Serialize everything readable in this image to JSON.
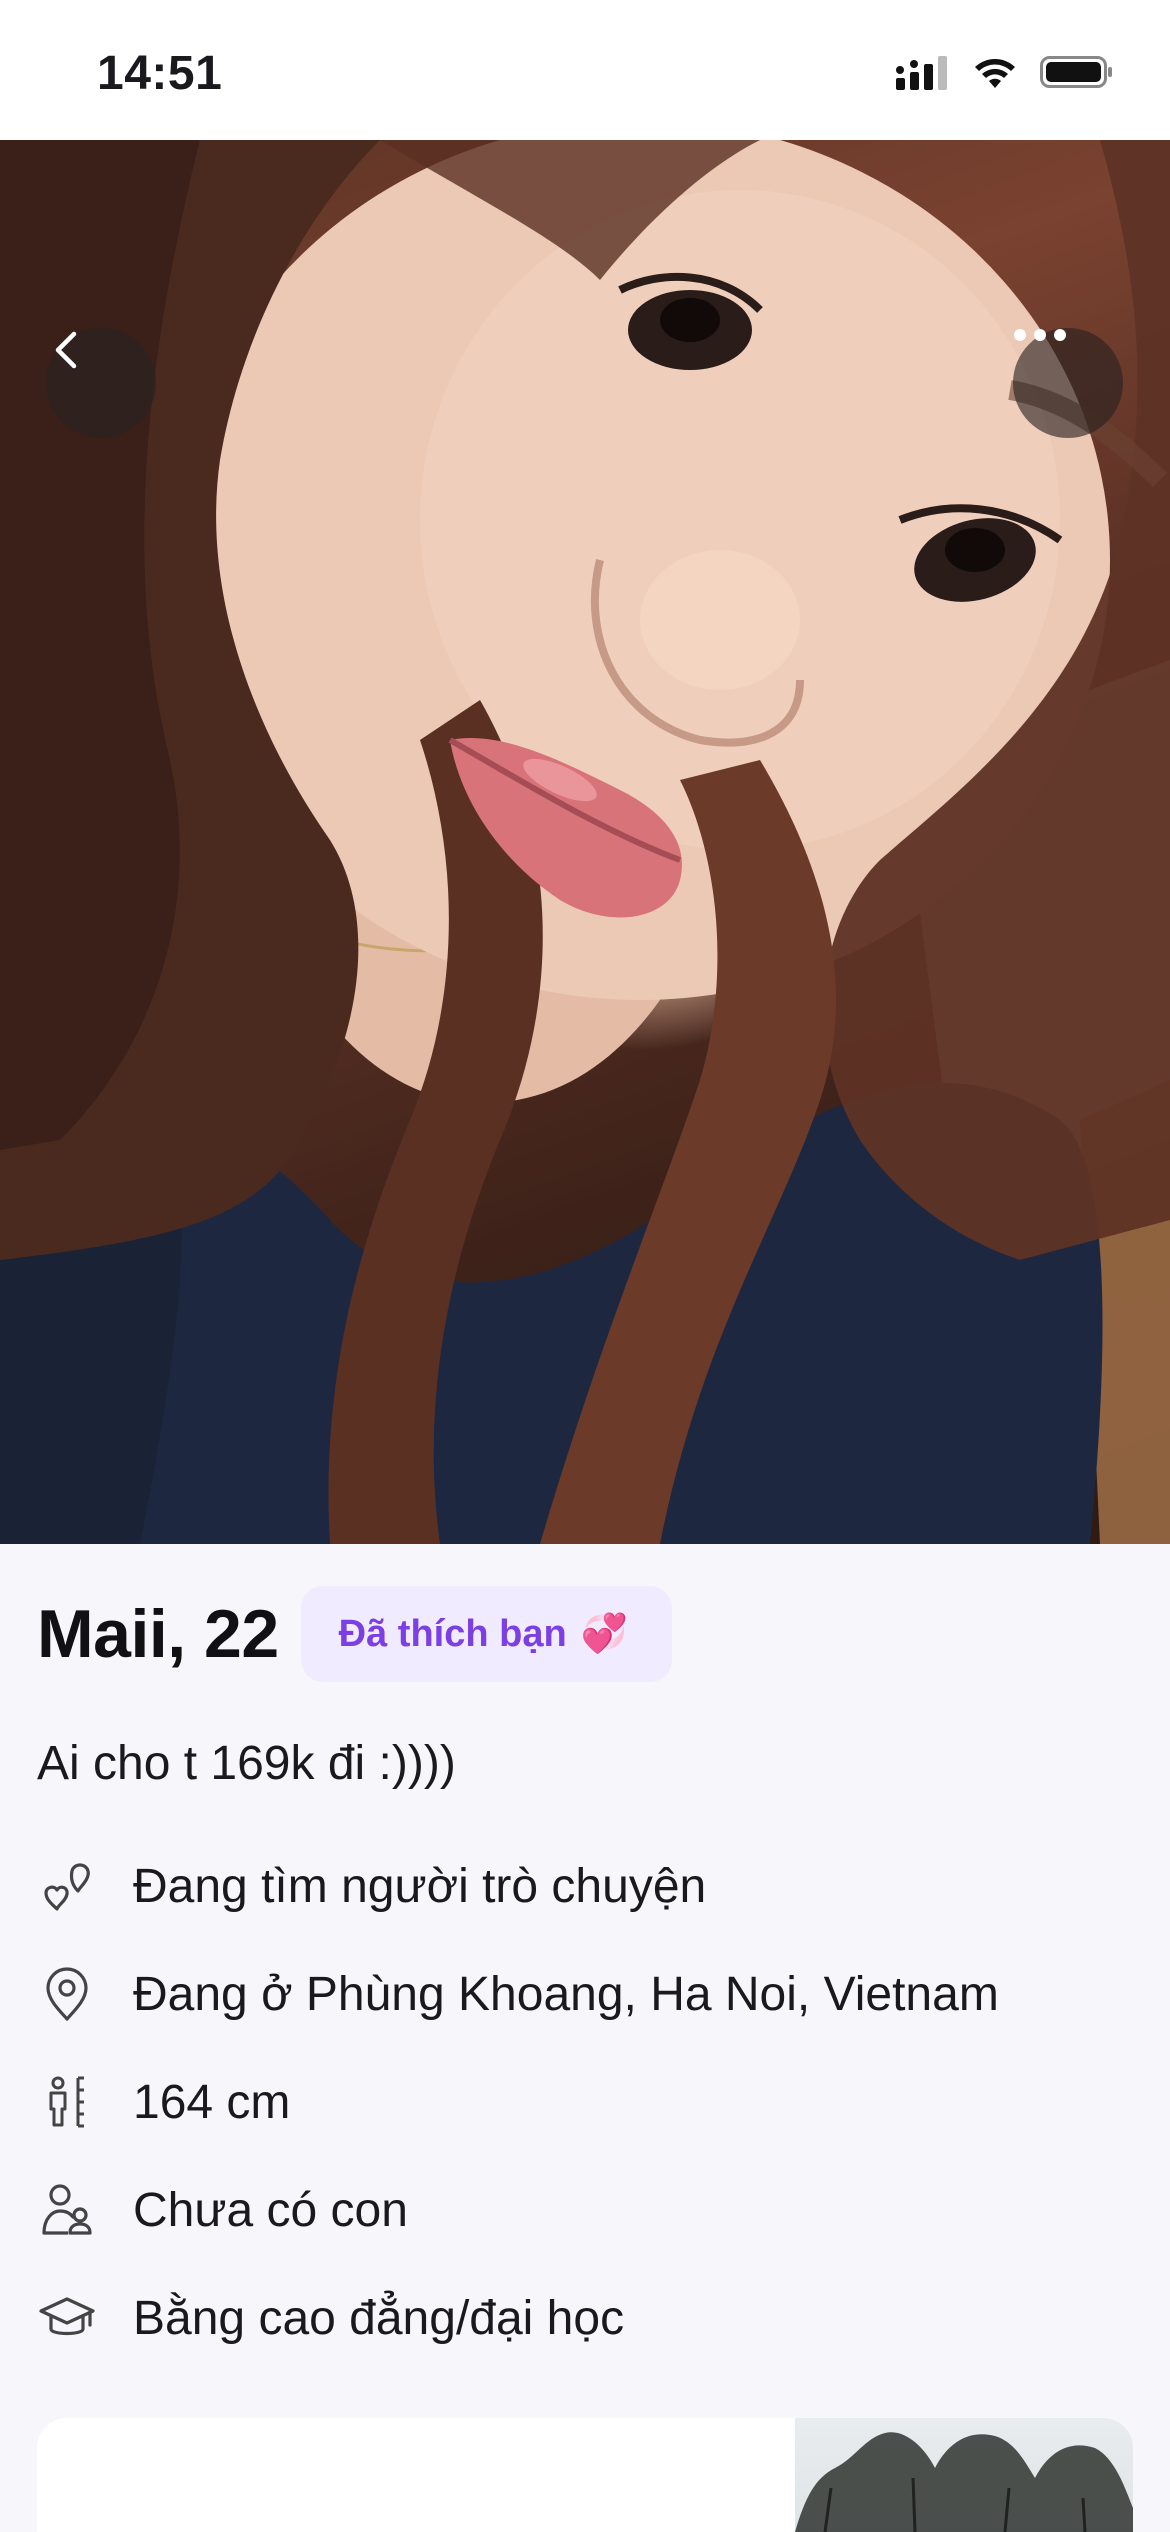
{
  "status_bar": {
    "time": "14:51"
  },
  "profile": {
    "name_age": "Maii, 22",
    "liked_badge": {
      "label": "Đã thích bạn",
      "emoji": "💞"
    },
    "bio": "Ai cho t 169k đi :))))",
    "attributes": [
      {
        "icon": "hearts-icon",
        "label": "Đang tìm người trò chuyện"
      },
      {
        "icon": "location-pin-icon",
        "label": "Đang ở Phùng Khoang, Ha Noi, Vietnam"
      },
      {
        "icon": "height-icon",
        "label": "164 cm"
      },
      {
        "icon": "children-icon",
        "label": "Chưa có con"
      },
      {
        "icon": "graduation-cap-icon",
        "label": "Bằng cao đẳng/đại học"
      }
    ]
  },
  "colors": {
    "accent": "#7b3fe4",
    "badge_bg": "#f1ebff",
    "page_bg": "#f7f6fb"
  }
}
